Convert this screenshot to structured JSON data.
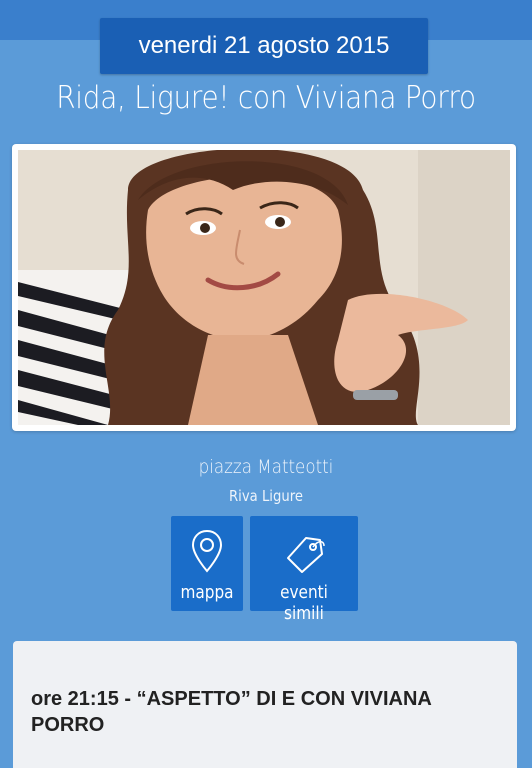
{
  "event": {
    "date": "venerdi 21 agosto 2015",
    "title": "Rida, Ligure! con Viviana Porro",
    "venue": "piazza Matteotti",
    "city": "Riva Ligure",
    "details": "ore 21:15 - “ASPETTO” DI E CON VIVIANA PORRO"
  },
  "actions": {
    "map_label": "mappa",
    "similar_label": "eventi simili"
  },
  "icons": {
    "map": "map-pin-icon",
    "similar": "tag-icon"
  },
  "colors": {
    "background": "#5b9bd8",
    "header": "#3a7fcc",
    "badge": "#1a5fb4",
    "button": "#1a6dc9",
    "card": "#eff1f4"
  }
}
